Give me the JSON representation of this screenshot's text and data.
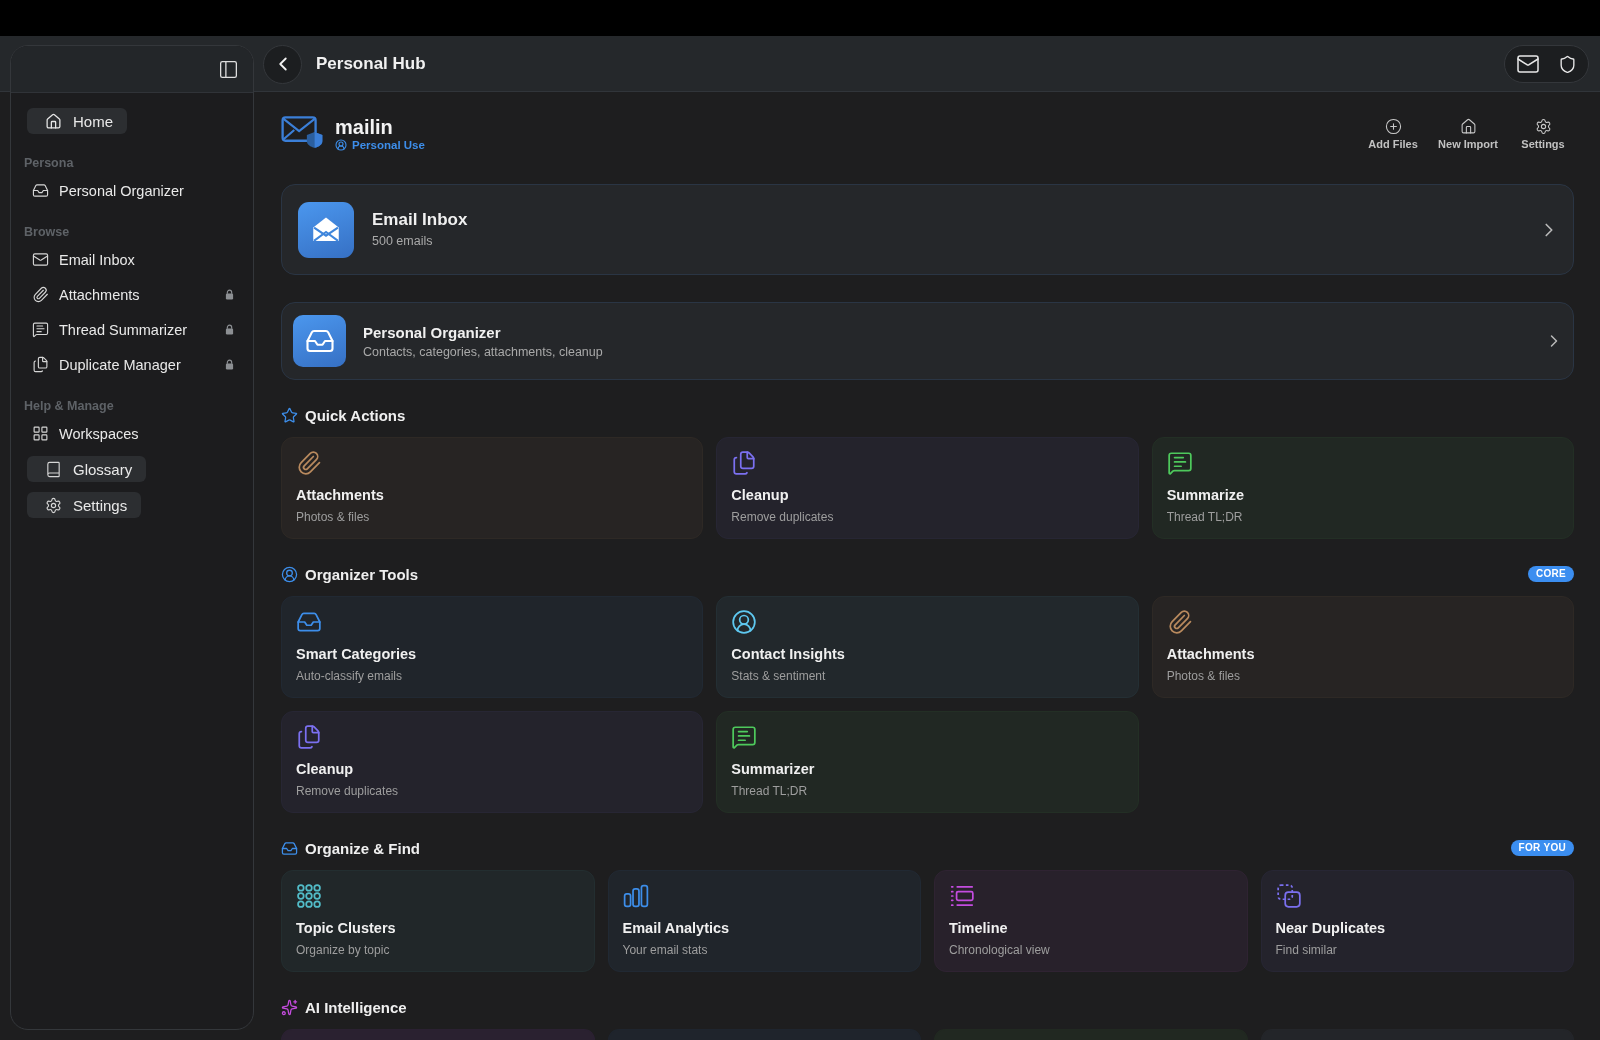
{
  "sidebar": {
    "home": {
      "label": "Home"
    },
    "sections": [
      {
        "title": "Persona",
        "items": [
          {
            "label": "Personal Organizer",
            "kind": "organizer",
            "locked": false
          }
        ]
      },
      {
        "title": "Browse",
        "items": [
          {
            "label": "Email Inbox",
            "kind": "inbox",
            "locked": false
          },
          {
            "label": "Attachments",
            "kind": "attachments",
            "locked": true
          },
          {
            "label": "Thread Summarizer",
            "kind": "summarizer",
            "locked": true
          },
          {
            "label": "Duplicate Manager",
            "kind": "duplicates",
            "locked": true
          }
        ]
      },
      {
        "title": "Help & Manage",
        "items": [
          {
            "label": "Workspaces",
            "kind": "workspaces",
            "locked": false
          },
          {
            "label": "Glossary",
            "kind": "glossary",
            "locked": false
          },
          {
            "label": "Settings",
            "kind": "settings",
            "locked": false
          }
        ]
      }
    ]
  },
  "header": {
    "title": "Personal Hub"
  },
  "app": {
    "name": "mailin",
    "plan": "Personal Use",
    "actions": [
      {
        "label": "Add Files",
        "kind": "add"
      },
      {
        "label": "New Import",
        "kind": "import"
      },
      {
        "label": "Settings",
        "kind": "settings"
      }
    ]
  },
  "featured": [
    {
      "title": "Email Inbox",
      "subtitle": "500 emails",
      "kind": "inbox"
    },
    {
      "title": "Personal Organizer",
      "subtitle": "Contacts, categories, attachments, cleanup",
      "kind": "organizer"
    }
  ],
  "sections": [
    {
      "title": "Quick Actions",
      "kind": "quick",
      "cards": [
        {
          "title": "Attachments",
          "subtitle": "Photos & files",
          "kind": "attachments",
          "color": "#b98a5e"
        },
        {
          "title": "Cleanup",
          "subtitle": "Remove duplicates",
          "kind": "cleanup",
          "color": "#7b70f0"
        },
        {
          "title": "Summarize",
          "subtitle": "Thread TL;DR",
          "kind": "summary",
          "color": "#4ec95c"
        }
      ]
    },
    {
      "title": "Organizer Tools",
      "kind": "tools",
      "badge": "CORE",
      "cards": [
        {
          "title": "Smart Categories",
          "subtitle": "Auto-classify emails",
          "kind": "categories",
          "color": "#3d8eea"
        },
        {
          "title": "Contact Insights",
          "subtitle": "Stats & sentiment",
          "kind": "contacts",
          "color": "#5ec8f0"
        },
        {
          "title": "Attachments",
          "subtitle": "Photos & files",
          "kind": "attachments",
          "color": "#b98a5e"
        },
        {
          "title": "Cleanup",
          "subtitle": "Remove duplicates",
          "kind": "cleanup",
          "color": "#7b70f0"
        },
        {
          "title": "Summarizer",
          "subtitle": "Thread TL;DR",
          "kind": "summary",
          "color": "#4ec95c"
        }
      ]
    },
    {
      "title": "Organize & Find",
      "kind": "organize",
      "badge": "FOR YOU",
      "cards": [
        {
          "title": "Topic Clusters",
          "subtitle": "Organize by topic",
          "kind": "clusters",
          "color": "#52bcc8"
        },
        {
          "title": "Email Analytics",
          "subtitle": "Your email stats",
          "kind": "analytics",
          "color": "#3d8eea"
        },
        {
          "title": "Timeline",
          "subtitle": "Chronological view",
          "kind": "timeline",
          "color": "#c44ce0"
        },
        {
          "title": "Near Duplicates",
          "subtitle": "Find similar",
          "kind": "duplicates",
          "color": "#7b70f0"
        }
      ]
    },
    {
      "title": "AI Intelligence",
      "kind": "ai",
      "cards": [
        {
          "color": "#2a2130"
        },
        {
          "color": "#1f242c"
        },
        {
          "color": "#212821"
        },
        {
          "color": "#232529"
        }
      ]
    }
  ]
}
